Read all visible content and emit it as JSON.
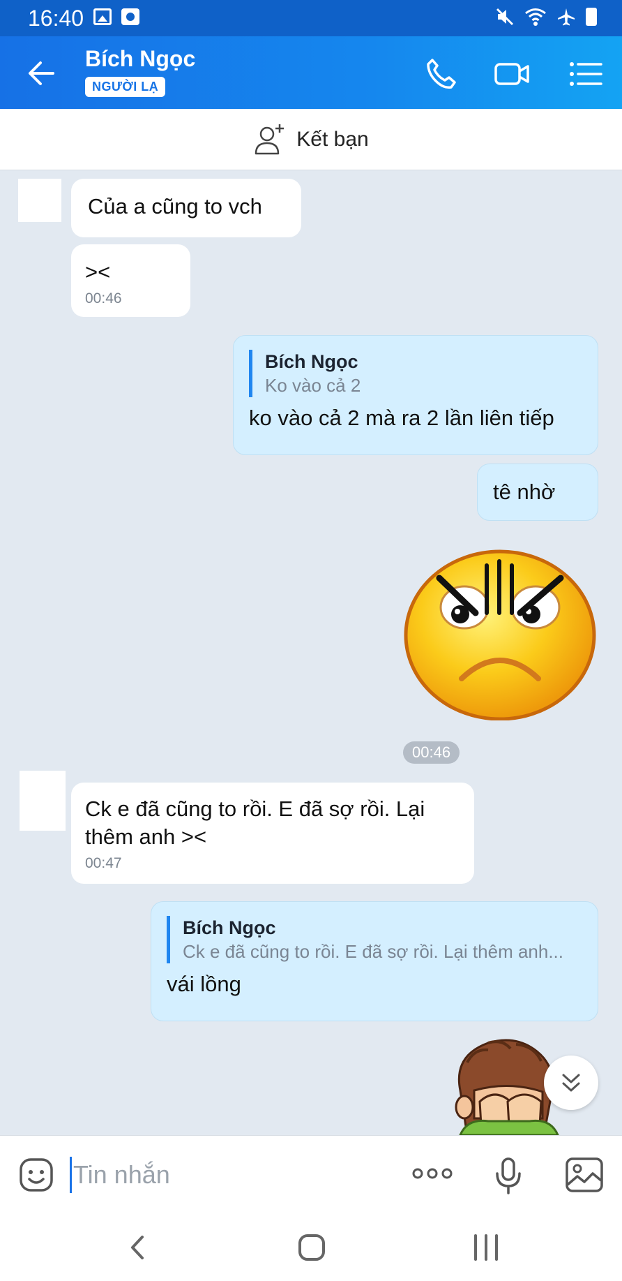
{
  "status_bar": {
    "time": "16:40",
    "icons": [
      "gallery-icon",
      "camera-app-icon",
      "mute-icon",
      "wifi-icon",
      "airplane-icon",
      "battery-icon"
    ]
  },
  "header": {
    "contact_name": "Bích Ngọc",
    "badge": "NGƯỜI LẠ",
    "icons": [
      "back-arrow-icon",
      "phone-icon",
      "video-camera-icon",
      "list-menu-icon"
    ]
  },
  "add_friend": {
    "label": "Kết bạn",
    "icon": "add-friend-icon"
  },
  "messages": [
    {
      "direction": "in",
      "text": "Của a cũng to vch"
    },
    {
      "direction": "in",
      "text": "><",
      "time": "00:46"
    },
    {
      "direction": "out",
      "quote": {
        "name": "Bích Ngọc",
        "text": "Ko vào cả 2"
      },
      "text": "ko vào cả 2 mà ra 2 lần liên tiếp"
    },
    {
      "direction": "out",
      "text": "tê nhờ"
    },
    {
      "direction": "out",
      "sticker": "angry-face-sticker"
    },
    {
      "type": "time",
      "text": "00:46"
    },
    {
      "direction": "in",
      "text": "Ck e đã cũng to rồi. E đã sợ rồi. Lại thêm anh ><",
      "time": "00:47"
    },
    {
      "direction": "out",
      "quote": {
        "name": "Bích Ngọc",
        "text": "Ck e đã cũng to rồi. E đã sợ rồi. Lại thêm anh..."
      },
      "text": "vái lồng"
    },
    {
      "direction": "out",
      "sticker": "boy-covering-face-sticker"
    }
  ],
  "input": {
    "placeholder": "Tin nhắn",
    "icons": [
      "emoji-icon",
      "more-dots-icon",
      "microphone-icon",
      "image-icon"
    ]
  },
  "colors": {
    "header_start": "#1671e6",
    "header_end": "#14a3f3",
    "status_bar": "#0f61c8",
    "chat_bg": "#e2e9f1",
    "outgoing_bubble": "#d4efff",
    "incoming_bubble": "#ffffff",
    "quote_bar": "#1f86f0"
  }
}
